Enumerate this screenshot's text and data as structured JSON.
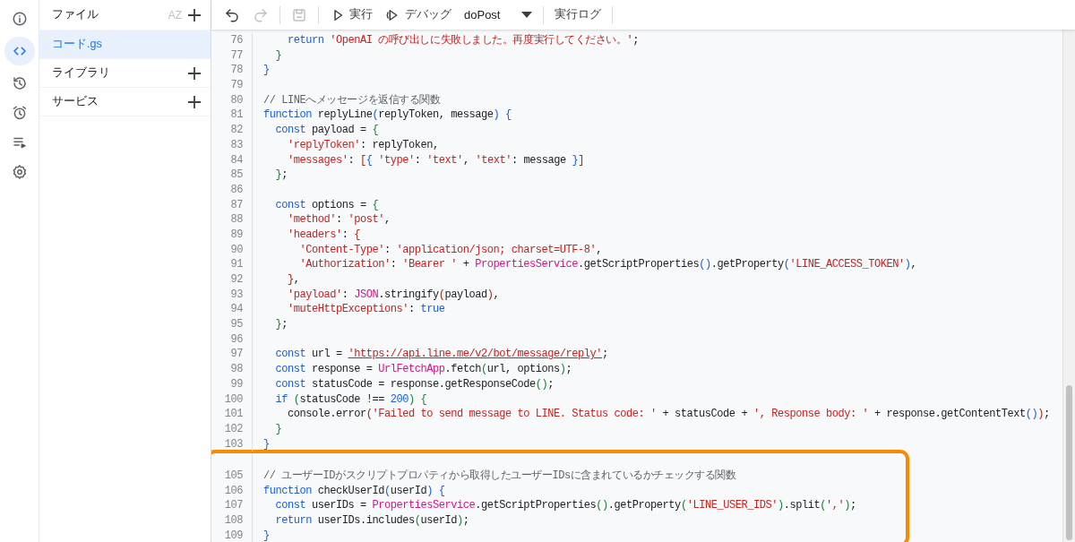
{
  "rail": [
    {
      "kind": "info",
      "selected": false
    },
    {
      "kind": "code",
      "selected": true
    },
    {
      "kind": "history",
      "selected": false
    },
    {
      "kind": "alarm",
      "selected": false
    },
    {
      "kind": "executions",
      "selected": false
    },
    {
      "kind": "settings",
      "selected": false
    }
  ],
  "files": {
    "title": "ファイル",
    "sort_label": "AZ",
    "items": [
      {
        "name": "コード.gs",
        "selected": true
      }
    ]
  },
  "sections": [
    {
      "title": "ライブラリ"
    },
    {
      "title": "サービス"
    }
  ],
  "toolbar": [
    {
      "kind": "undo",
      "disabled": false
    },
    {
      "kind": "redo",
      "disabled": true
    },
    {
      "kind": "divider"
    },
    {
      "kind": "save",
      "disabled": true
    },
    {
      "kind": "divider"
    },
    {
      "kind": "run",
      "label": "実行",
      "disabled": false
    },
    {
      "kind": "debug",
      "label": "デバッグ",
      "disabled": false
    },
    {
      "kind": "select",
      "value": "doPost",
      "disabled": false
    },
    {
      "kind": "divider"
    },
    {
      "kind": "button",
      "label": "実行ログ",
      "disabled": false
    },
    {
      "kind": "divider"
    }
  ],
  "lines": [
    {
      "kind": "code",
      "number": "76",
      "highlighted": false,
      "tokens": [
        {
          "kind": "keyword",
          "text": "    return"
        },
        {
          "kind": "string",
          "text": " 'OpenAI の呼び出しに失敗しました。再度実行してください。'"
        },
        {
          "kind": "plain",
          "text": ";"
        }
      ]
    },
    {
      "kind": "code",
      "number": "77",
      "highlighted": false,
      "tokens": [
        {
          "kind": "paren2",
          "text": "  }"
        }
      ]
    },
    {
      "kind": "code",
      "number": "78",
      "highlighted": false,
      "tokens": [
        {
          "kind": "paren1",
          "text": "}"
        }
      ]
    },
    {
      "kind": "code",
      "number": "79",
      "highlighted": false
    },
    {
      "kind": "code",
      "number": "80",
      "highlighted": false,
      "tokens": [
        {
          "kind": "comment",
          "text": "// LINEへメッセージを返信する関数"
        }
      ]
    },
    {
      "kind": "code",
      "number": "81",
      "highlighted": false,
      "tokens": [
        {
          "kind": "keyword",
          "text": "function"
        },
        {
          "kind": "plain",
          "text": " replyLine"
        },
        {
          "kind": "paren1",
          "text": "("
        },
        {
          "kind": "plain",
          "text": "replyToken, message"
        },
        {
          "kind": "paren1",
          "text": ")"
        },
        {
          "kind": "paren1",
          "text": " {"
        }
      ]
    },
    {
      "kind": "code",
      "number": "82",
      "highlighted": false,
      "tokens": [
        {
          "kind": "keyword",
          "text": "  const"
        },
        {
          "kind": "plain",
          "text": " payload = "
        },
        {
          "kind": "paren2",
          "text": "{"
        }
      ]
    },
    {
      "kind": "code",
      "number": "83",
      "highlighted": false,
      "tokens": [
        {
          "kind": "string",
          "text": "    'replyToken'"
        },
        {
          "kind": "plain",
          "text": ": replyToken,"
        }
      ]
    },
    {
      "kind": "code",
      "number": "84",
      "highlighted": false,
      "tokens": [
        {
          "kind": "string",
          "text": "    'messages'"
        },
        {
          "kind": "plain",
          "text": ": "
        },
        {
          "kind": "paren3",
          "text": "["
        },
        {
          "kind": "paren1",
          "text": "{"
        },
        {
          "kind": "string",
          "text": " 'type'"
        },
        {
          "kind": "plain",
          "text": ": "
        },
        {
          "kind": "string",
          "text": "'text'"
        },
        {
          "kind": "plain",
          "text": ", "
        },
        {
          "kind": "string",
          "text": "'text'"
        },
        {
          "kind": "plain",
          "text": ": message "
        },
        {
          "kind": "paren1",
          "text": "}"
        },
        {
          "kind": "paren3",
          "text": "]"
        }
      ]
    },
    {
      "kind": "code",
      "number": "85",
      "highlighted": false,
      "tokens": [
        {
          "kind": "paren2",
          "text": "  }"
        },
        {
          "kind": "plain",
          "text": ";"
        }
      ]
    },
    {
      "kind": "code",
      "number": "86",
      "highlighted": false
    },
    {
      "kind": "code",
      "number": "87",
      "highlighted": false,
      "tokens": [
        {
          "kind": "keyword",
          "text": "  const"
        },
        {
          "kind": "plain",
          "text": " options = "
        },
        {
          "kind": "paren2",
          "text": "{"
        }
      ]
    },
    {
      "kind": "code",
      "number": "88",
      "highlighted": false,
      "tokens": [
        {
          "kind": "string",
          "text": "    'method'"
        },
        {
          "kind": "plain",
          "text": ": "
        },
        {
          "kind": "string",
          "text": "'post'"
        },
        {
          "kind": "plain",
          "text": ","
        }
      ]
    },
    {
      "kind": "code",
      "number": "89",
      "highlighted": false,
      "tokens": [
        {
          "kind": "string",
          "text": "    'headers'"
        },
        {
          "kind": "plain",
          "text": ": "
        },
        {
          "kind": "paren3",
          "text": "{"
        }
      ]
    },
    {
      "kind": "code",
      "number": "90",
      "highlighted": false,
      "tokens": [
        {
          "kind": "string",
          "text": "      'Content-Type'"
        },
        {
          "kind": "plain",
          "text": ": "
        },
        {
          "kind": "string",
          "text": "'application/json; charset=UTF-8'"
        },
        {
          "kind": "plain",
          "text": ","
        }
      ]
    },
    {
      "kind": "code",
      "number": "91",
      "highlighted": false,
      "tokens": [
        {
          "kind": "string",
          "text": "      'Authorization'"
        },
        {
          "kind": "plain",
          "text": ": "
        },
        {
          "kind": "string",
          "text": "'Bearer '"
        },
        {
          "kind": "plain",
          "text": " + "
        },
        {
          "kind": "global",
          "text": "PropertiesService"
        },
        {
          "kind": "plain",
          "text": ".getScriptProperties"
        },
        {
          "kind": "paren1",
          "text": "()"
        },
        {
          "kind": "plain",
          "text": ".getProperty"
        },
        {
          "kind": "paren1",
          "text": "("
        },
        {
          "kind": "string",
          "text": "'LINE_ACCESS_TOKEN'"
        },
        {
          "kind": "paren1",
          "text": ")"
        },
        {
          "kind": "plain",
          "text": ","
        }
      ]
    },
    {
      "kind": "code",
      "number": "92",
      "highlighted": false,
      "tokens": [
        {
          "kind": "paren3",
          "text": "    }"
        },
        {
          "kind": "plain",
          "text": ","
        }
      ]
    },
    {
      "kind": "code",
      "number": "93",
      "highlighted": false,
      "tokens": [
        {
          "kind": "string",
          "text": "    'payload'"
        },
        {
          "kind": "plain",
          "text": ": "
        },
        {
          "kind": "global",
          "text": "JSON"
        },
        {
          "kind": "plain",
          "text": ".stringify"
        },
        {
          "kind": "paren3",
          "text": "("
        },
        {
          "kind": "plain",
          "text": "payload"
        },
        {
          "kind": "paren3",
          "text": ")"
        },
        {
          "kind": "plain",
          "text": ","
        }
      ]
    },
    {
      "kind": "code",
      "number": "94",
      "highlighted": false,
      "tokens": [
        {
          "kind": "string",
          "text": "    'muteHttpExceptions'"
        },
        {
          "kind": "plain",
          "text": ": "
        },
        {
          "kind": "keyword",
          "text": "true"
        }
      ]
    },
    {
      "kind": "code",
      "number": "95",
      "highlighted": false,
      "tokens": [
        {
          "kind": "paren2",
          "text": "  }"
        },
        {
          "kind": "plain",
          "text": ";"
        }
      ]
    },
    {
      "kind": "code",
      "number": "96",
      "highlighted": false
    },
    {
      "kind": "code",
      "number": "97",
      "highlighted": false,
      "tokens": [
        {
          "kind": "keyword",
          "text": "  const"
        },
        {
          "kind": "plain",
          "text": " url = "
        },
        {
          "kind": "url",
          "text": "'https://api.line.me/v2/bot/message/reply'"
        },
        {
          "kind": "plain",
          "text": ";"
        }
      ]
    },
    {
      "kind": "code",
      "number": "98",
      "highlighted": false,
      "tokens": [
        {
          "kind": "keyword",
          "text": "  const"
        },
        {
          "kind": "plain",
          "text": " response = "
        },
        {
          "kind": "global",
          "text": "UrlFetchApp"
        },
        {
          "kind": "plain",
          "text": ".fetch"
        },
        {
          "kind": "paren2",
          "text": "("
        },
        {
          "kind": "plain",
          "text": "url, options"
        },
        {
          "kind": "paren2",
          "text": ")"
        },
        {
          "kind": "plain",
          "text": ";"
        }
      ]
    },
    {
      "kind": "code",
      "number": "99",
      "highlighted": false,
      "tokens": [
        {
          "kind": "keyword",
          "text": "  const"
        },
        {
          "kind": "plain",
          "text": " statusCode = response.getResponseCode"
        },
        {
          "kind": "paren2",
          "text": "()"
        },
        {
          "kind": "plain",
          "text": ";"
        }
      ]
    },
    {
      "kind": "code",
      "number": "100",
      "highlighted": false,
      "tokens": [
        {
          "kind": "keyword",
          "text": "  if"
        },
        {
          "kind": "paren2",
          "text": " ("
        },
        {
          "kind": "plain",
          "text": "statusCode !== "
        },
        {
          "kind": "number",
          "text": "200"
        },
        {
          "kind": "paren2",
          "text": ")"
        },
        {
          "kind": "paren2",
          "text": " {"
        }
      ]
    },
    {
      "kind": "code",
      "number": "101",
      "highlighted": false,
      "tokens": [
        {
          "kind": "plain",
          "text": "    console.error"
        },
        {
          "kind": "paren3",
          "text": "("
        },
        {
          "kind": "string",
          "text": "'Failed to send message to LINE. Status code: '"
        },
        {
          "kind": "plain",
          "text": " + statusCode + "
        },
        {
          "kind": "string",
          "text": "', Response body: '"
        },
        {
          "kind": "plain",
          "text": " + response.getContentText"
        },
        {
          "kind": "paren1",
          "text": "()"
        },
        {
          "kind": "paren3",
          "text": ")"
        },
        {
          "kind": "plain",
          "text": ";"
        }
      ]
    },
    {
      "kind": "code",
      "number": "102",
      "highlighted": false,
      "tokens": [
        {
          "kind": "paren2",
          "text": "  }"
        }
      ]
    },
    {
      "kind": "code",
      "number": "103",
      "highlighted": false,
      "tokens": [
        {
          "kind": "paren1",
          "text": "}"
        }
      ]
    },
    {
      "kind": "hidden",
      "highlighted": true
    },
    {
      "kind": "code",
      "number": "105",
      "highlighted": true,
      "tokens": [
        {
          "kind": "comment",
          "text": "// ユーザーIDがスクリプトプロパティから取得したユーザーIDsに含まれているかチェックする関数"
        }
      ]
    },
    {
      "kind": "code",
      "number": "106",
      "highlighted": true,
      "tokens": [
        {
          "kind": "keyword",
          "text": "function"
        },
        {
          "kind": "plain",
          "text": " checkUserId"
        },
        {
          "kind": "paren1",
          "text": "("
        },
        {
          "kind": "plain",
          "text": "userId"
        },
        {
          "kind": "paren1",
          "text": ")"
        },
        {
          "kind": "paren1",
          "text": " {"
        }
      ]
    },
    {
      "kind": "code",
      "number": "107",
      "highlighted": true,
      "tokens": [
        {
          "kind": "keyword",
          "text": "  const"
        },
        {
          "kind": "plain",
          "text": " userIDs = "
        },
        {
          "kind": "global",
          "text": "PropertiesService"
        },
        {
          "kind": "plain",
          "text": ".getScriptProperties"
        },
        {
          "kind": "paren2",
          "text": "()"
        },
        {
          "kind": "plain",
          "text": ".getProperty"
        },
        {
          "kind": "paren2",
          "text": "("
        },
        {
          "kind": "string",
          "text": "'LINE_USER_IDS'"
        },
        {
          "kind": "paren2",
          "text": ")"
        },
        {
          "kind": "plain",
          "text": ".split"
        },
        {
          "kind": "paren2",
          "text": "("
        },
        {
          "kind": "string",
          "text": "','"
        },
        {
          "kind": "paren2",
          "text": ")"
        },
        {
          "kind": "plain",
          "text": ";"
        }
      ]
    },
    {
      "kind": "code",
      "number": "108",
      "highlighted": true,
      "tokens": [
        {
          "kind": "keyword",
          "text": "  return"
        },
        {
          "kind": "plain",
          "text": " userIDs.includes"
        },
        {
          "kind": "paren2",
          "text": "("
        },
        {
          "kind": "plain",
          "text": "userId"
        },
        {
          "kind": "paren2",
          "text": ")"
        },
        {
          "kind": "plain",
          "text": ";"
        }
      ]
    },
    {
      "kind": "code",
      "number": "109",
      "highlighted": true,
      "tokens": [
        {
          "kind": "paren1",
          "text": "}"
        }
      ]
    }
  ]
}
